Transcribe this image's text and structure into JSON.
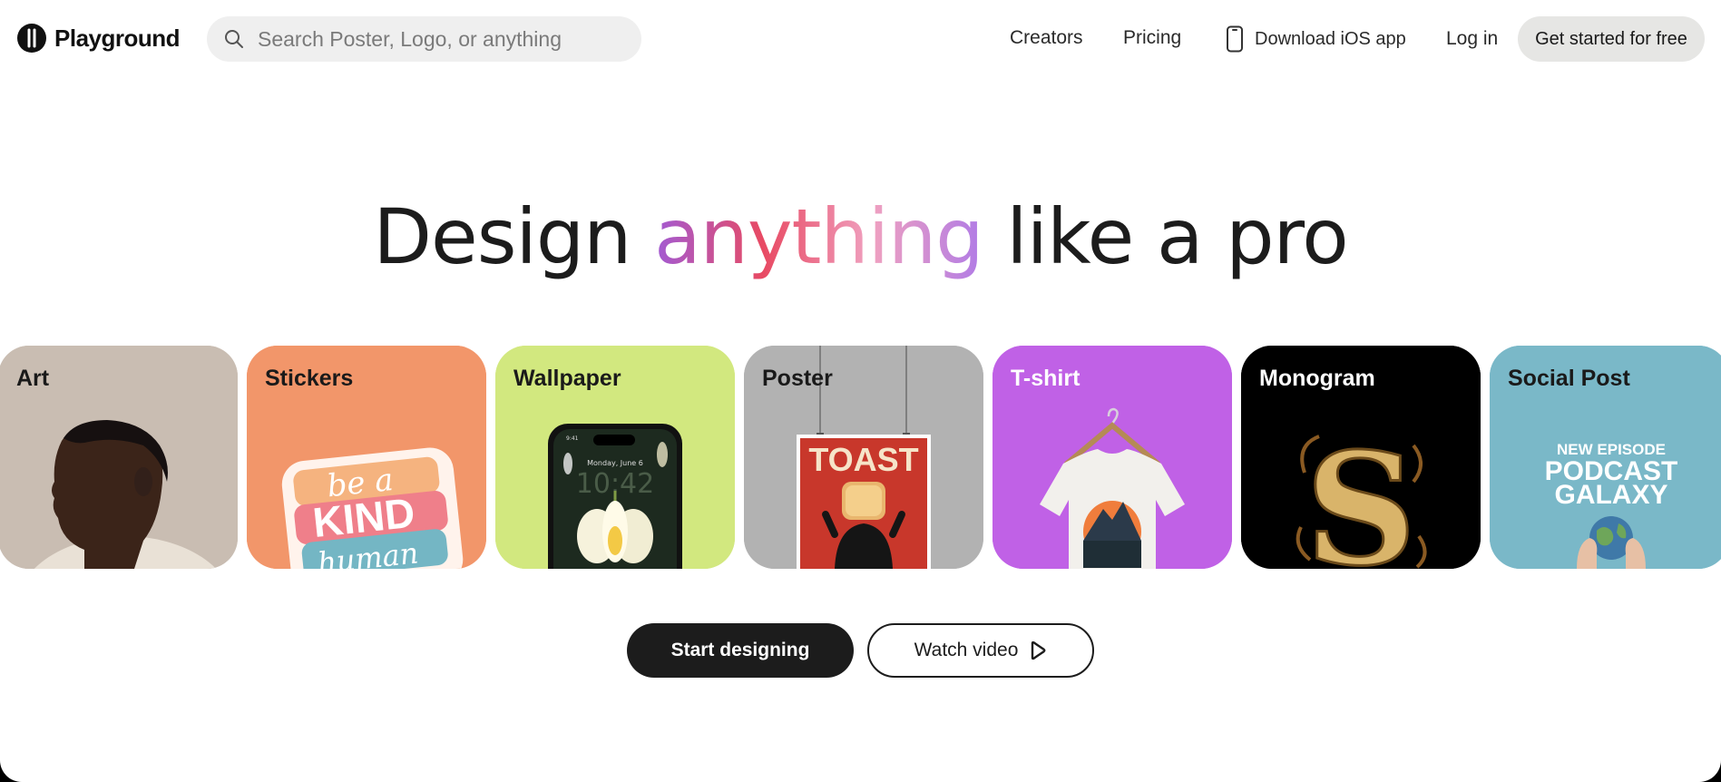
{
  "header": {
    "brand": "Playground",
    "search_placeholder": "Search Poster, Logo, or anything",
    "nav": {
      "creators": "Creators",
      "pricing": "Pricing",
      "ios": "Download iOS app",
      "login": "Log in"
    },
    "cta": "Get started for free"
  },
  "hero": {
    "before": "Design ",
    "highlight": "anything",
    "after": " like a pro"
  },
  "cards": [
    {
      "label": "Art",
      "bg": "#c9bdb2",
      "label_color": "#1a1a1a"
    },
    {
      "label": "Stickers",
      "bg": "#f2966a",
      "label_color": "#1a1a1a",
      "art_text": [
        "be a",
        "KIND",
        "human"
      ]
    },
    {
      "label": "Wallpaper",
      "bg": "#d2e87f",
      "label_color": "#1a1a1a",
      "phone_date": "Monday, June 6",
      "phone_time": "10:42",
      "phone_clock": "9:41"
    },
    {
      "label": "Poster",
      "bg": "#b2b2b2",
      "label_color": "#1a1a1a",
      "art_text": "TOAST"
    },
    {
      "label": "T-shirt",
      "bg": "#c061e6",
      "label_color": "#ffffff"
    },
    {
      "label": "Monogram",
      "bg": "#000000",
      "label_color": "#ffffff",
      "art_text": "S"
    },
    {
      "label": "Social Post",
      "bg": "#7ab8c8",
      "label_color": "#1a1a1a",
      "art_text": [
        "NEW EPISODE",
        "PODCAST",
        "GALAXY"
      ]
    }
  ],
  "actions": {
    "start": "Start designing",
    "watch": "Watch video"
  },
  "colors": {
    "primary": "#1c1c1c",
    "search_bg": "#efefef",
    "cta_bg": "#e6e6e4"
  }
}
